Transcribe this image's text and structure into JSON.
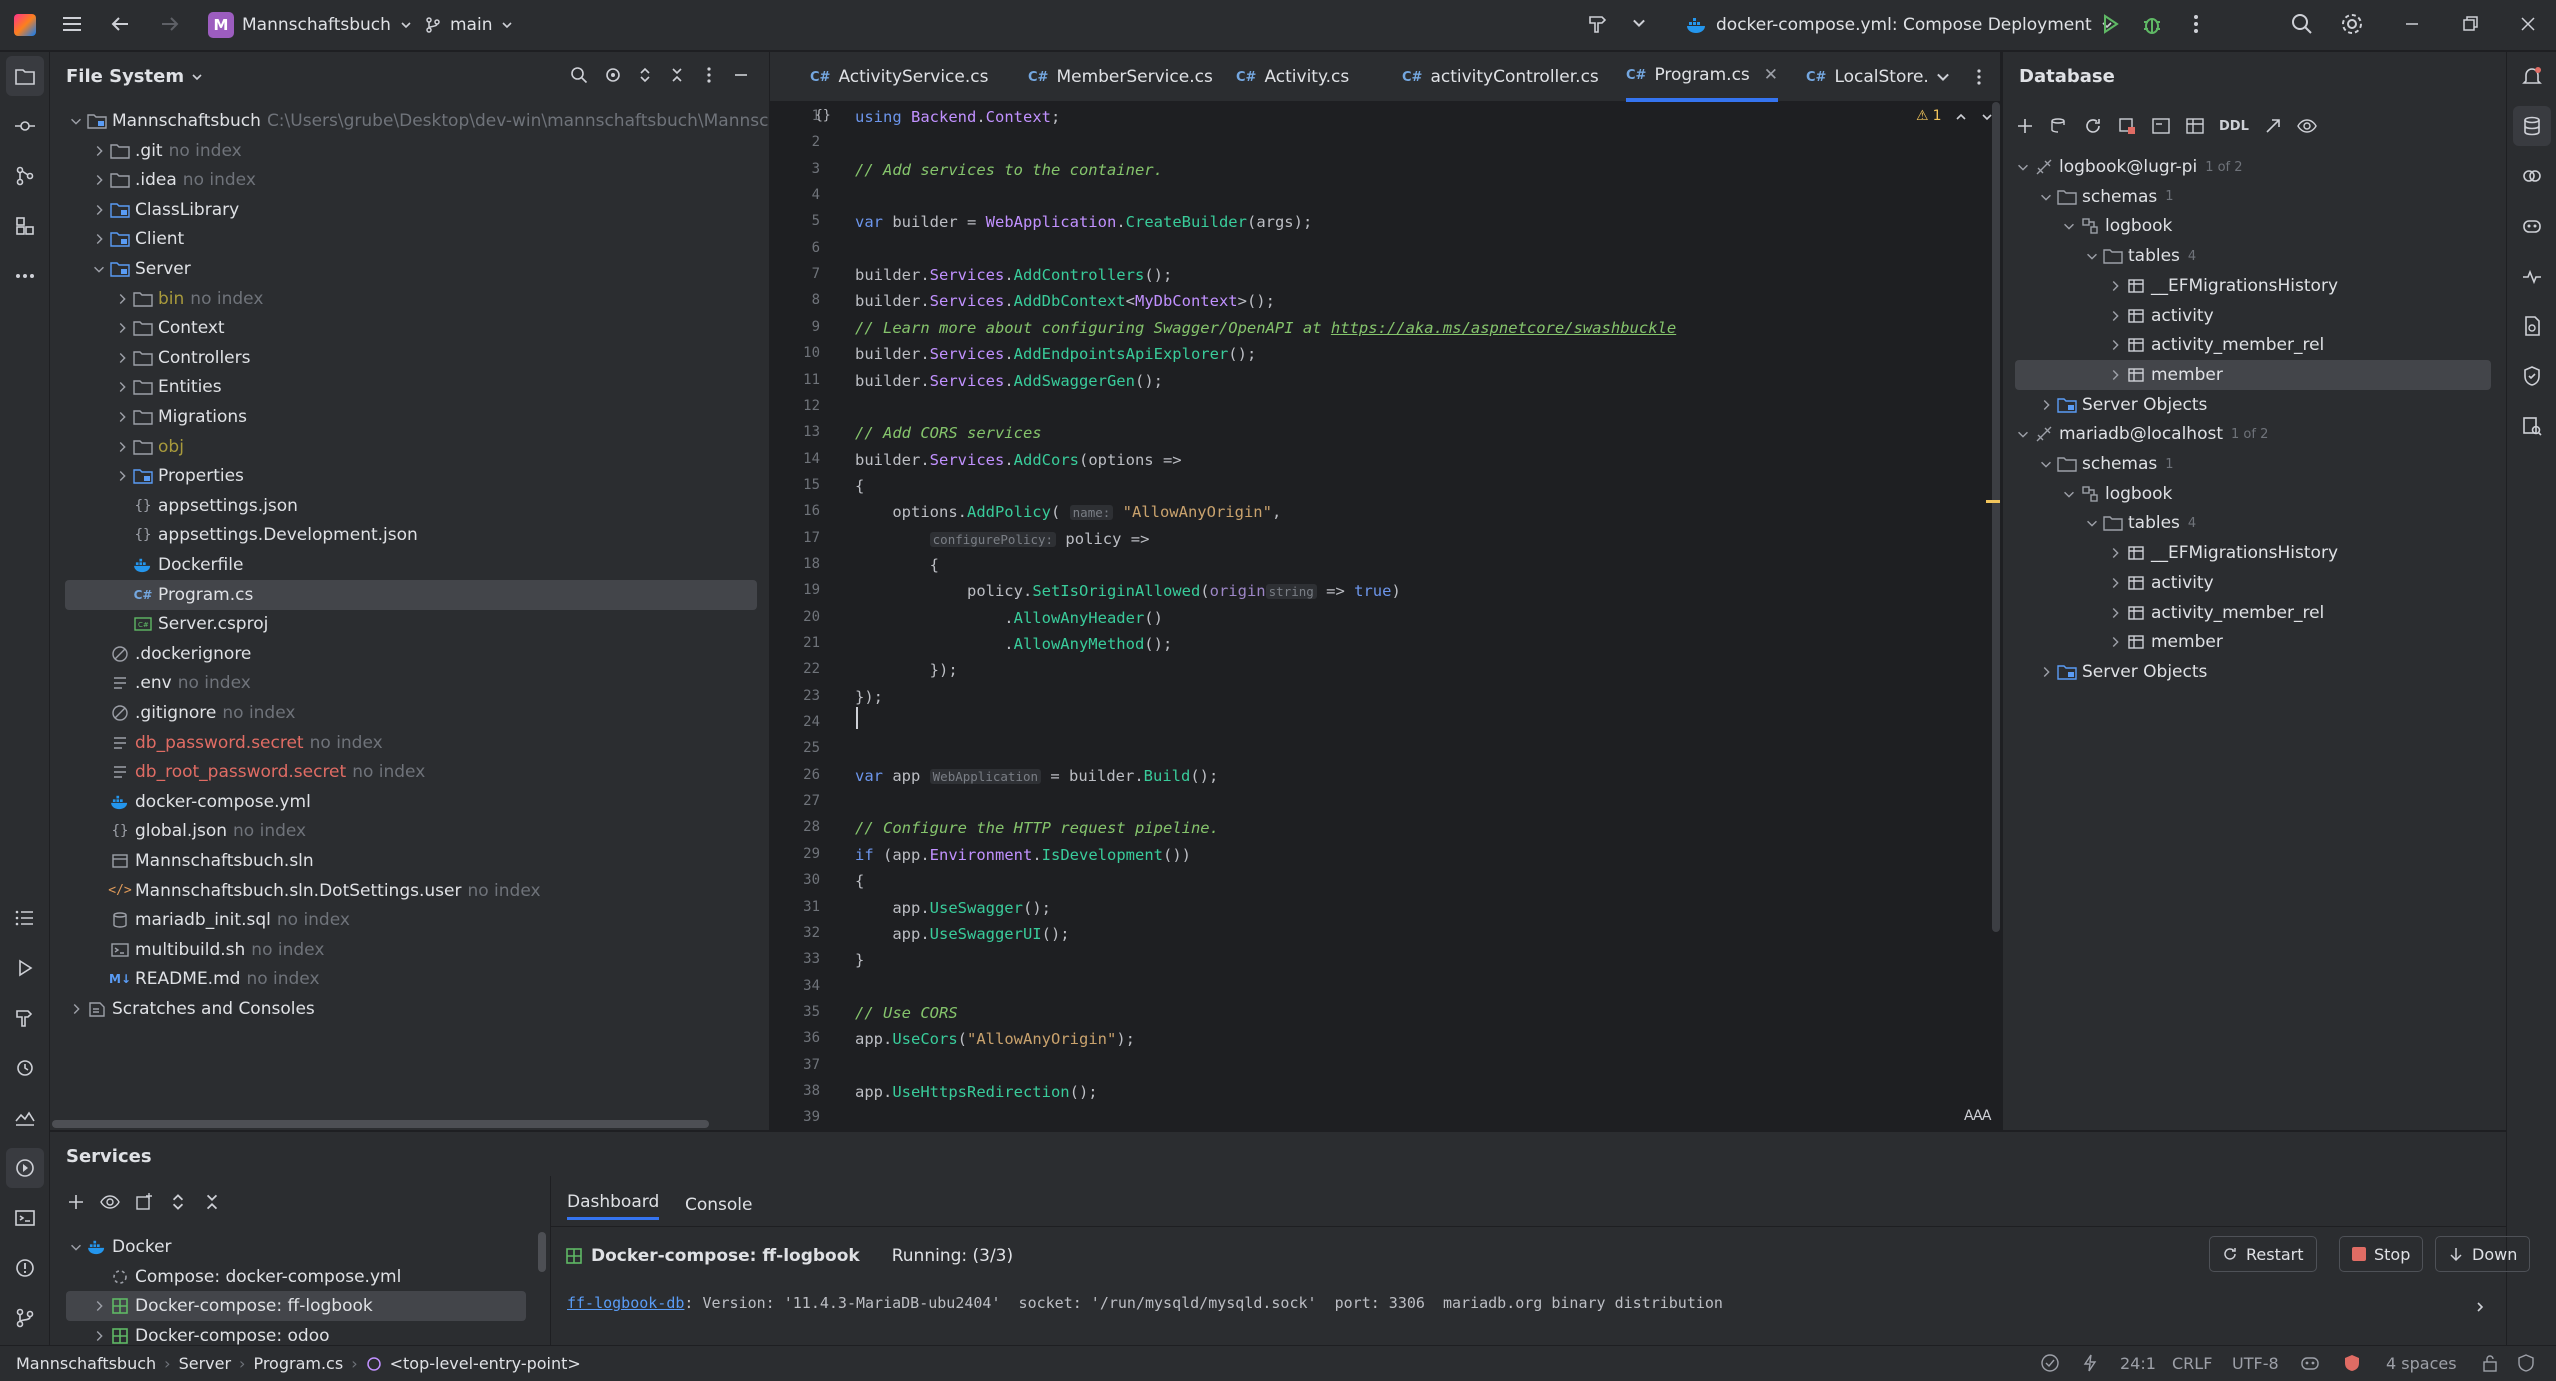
{
  "header": {
    "project_initial": "M",
    "project_name": "Mannschaftsbuch",
    "branch": "main",
    "run_config": "docker-compose.yml: Compose Deployment"
  },
  "filesystem": {
    "title": "File System",
    "root_name": "Mannschaftsbuch",
    "root_path": "C:\\Users\\grube\\Desktop\\dev-win\\mannschaftsbuch\\Mannschaftsbuch",
    "items": [
      {
        "label": "Mannschaftsbuch",
        "extra": "C:\\Users\\grube\\Desktop\\dev-win\\mannschaftsbuch\\Mannschaftsbuch",
        "level": 0,
        "chev": "down",
        "icon": "project-folder-icon"
      },
      {
        "label": ".git",
        "extra": "no index",
        "level": 1,
        "chev": "right",
        "icon": "folder-icon"
      },
      {
        "label": ".idea",
        "extra": "no index",
        "level": 1,
        "chev": "right",
        "icon": "folder-icon"
      },
      {
        "label": "ClassLibrary",
        "extra": "",
        "level": 1,
        "chev": "right",
        "icon": "module-folder-icon"
      },
      {
        "label": "Client",
        "extra": "",
        "level": 1,
        "chev": "right",
        "icon": "module-folder-icon"
      },
      {
        "label": "Server",
        "extra": "",
        "level": 1,
        "chev": "down",
        "icon": "module-folder-icon"
      },
      {
        "label": "bin",
        "extra": "no index",
        "level": 2,
        "chev": "right",
        "icon": "folder-icon",
        "color": "olive"
      },
      {
        "label": "Context",
        "extra": "",
        "level": 2,
        "chev": "right",
        "icon": "folder-icon"
      },
      {
        "label": "Controllers",
        "extra": "",
        "level": 2,
        "chev": "right",
        "icon": "folder-icon"
      },
      {
        "label": "Entities",
        "extra": "",
        "level": 2,
        "chev": "right",
        "icon": "folder-icon"
      },
      {
        "label": "Migrations",
        "extra": "",
        "level": 2,
        "chev": "right",
        "icon": "folder-icon"
      },
      {
        "label": "obj",
        "extra": "",
        "level": 2,
        "chev": "right",
        "icon": "folder-icon",
        "color": "olive"
      },
      {
        "label": "Properties",
        "extra": "",
        "level": 2,
        "chev": "right",
        "icon": "module-folder-icon"
      },
      {
        "label": "appsettings.json",
        "extra": "",
        "level": 2,
        "chev": "",
        "icon": "json-icon"
      },
      {
        "label": "appsettings.Development.json",
        "extra": "",
        "level": 2,
        "chev": "",
        "icon": "json-icon"
      },
      {
        "label": "Dockerfile",
        "extra": "",
        "level": 2,
        "chev": "",
        "icon": "docker-icon"
      },
      {
        "label": "Program.cs",
        "extra": "",
        "level": 2,
        "chev": "",
        "icon": "csharp-icon",
        "selected": true
      },
      {
        "label": "Server.csproj",
        "extra": "",
        "level": 2,
        "chev": "",
        "icon": "csproj-icon"
      },
      {
        "label": ".dockerignore",
        "extra": "",
        "level": 1,
        "chev": "",
        "icon": "ignore-icon"
      },
      {
        "label": ".env",
        "extra": "no index",
        "level": 1,
        "chev": "",
        "icon": "text-file-icon"
      },
      {
        "label": ".gitignore",
        "extra": "no index",
        "level": 1,
        "chev": "",
        "icon": "ignore-icon"
      },
      {
        "label": "db_password.secret",
        "extra": "no index",
        "level": 1,
        "chev": "",
        "icon": "text-file-icon",
        "color": "red"
      },
      {
        "label": "db_root_password.secret",
        "extra": "no index",
        "level": 1,
        "chev": "",
        "icon": "text-file-icon",
        "color": "red"
      },
      {
        "label": "docker-compose.yml",
        "extra": "",
        "level": 1,
        "chev": "",
        "icon": "docker-icon"
      },
      {
        "label": "global.json",
        "extra": "no index",
        "level": 1,
        "chev": "",
        "icon": "json-icon"
      },
      {
        "label": "Mannschaftsbuch.sln",
        "extra": "",
        "level": 1,
        "chev": "",
        "icon": "solution-icon"
      },
      {
        "label": "Mannschaftsbuch.sln.DotSettings.user",
        "extra": "no index",
        "level": 1,
        "chev": "",
        "icon": "xml-icon"
      },
      {
        "label": "mariadb_init.sql",
        "extra": "no index",
        "level": 1,
        "chev": "",
        "icon": "sql-icon"
      },
      {
        "label": "multibuild.sh",
        "extra": "no index",
        "level": 1,
        "chev": "",
        "icon": "shell-icon"
      },
      {
        "label": "README.md",
        "extra": "no index",
        "level": 1,
        "chev": "",
        "icon": "markdown-icon"
      },
      {
        "label": "Scratches and Consoles",
        "extra": "",
        "level": 0,
        "chev": "right",
        "icon": "scratches-icon"
      }
    ]
  },
  "editor": {
    "tabs": [
      {
        "label": "ActivityService.cs",
        "icon": "C#"
      },
      {
        "label": "MemberService.cs",
        "icon": "C#"
      },
      {
        "label": "Activity.cs",
        "icon": "C#"
      },
      {
        "label": "activityController.cs",
        "icon": "C#"
      },
      {
        "label": "Program.cs",
        "icon": "C#",
        "active": true
      },
      {
        "label": "LocalStore.",
        "icon": "C#"
      }
    ],
    "warning_count": "1",
    "lines": [
      [
        [
          "kw",
          "using "
        ],
        [
          "ty",
          "Backend"
        ],
        [
          "",
          "."
        ],
        [
          "ty",
          "Context"
        ],
        [
          "",
          ";"
        ]
      ],
      [],
      [
        [
          "cm",
          "// Add services to the container."
        ]
      ],
      [],
      [
        [
          "kw",
          "var "
        ],
        [
          "",
          "builder = "
        ],
        [
          "ty",
          "WebApplication"
        ],
        [
          "",
          "."
        ],
        [
          "me",
          "CreateBuilder"
        ],
        [
          "",
          "(args);"
        ]
      ],
      [],
      [
        [
          "",
          "builder."
        ],
        [
          "ty",
          "Services"
        ],
        [
          "",
          "."
        ],
        [
          "me",
          "AddControllers"
        ],
        [
          "",
          "();"
        ]
      ],
      [
        [
          "",
          "builder."
        ],
        [
          "ty",
          "Services"
        ],
        [
          "",
          "."
        ],
        [
          "me",
          "AddDbContext"
        ],
        [
          "",
          "<"
        ],
        [
          "ty",
          "MyDbContext"
        ],
        [
          "",
          ">();"
        ]
      ],
      [
        [
          "cm",
          "// Learn more about configuring Swagger/OpenAPI at "
        ],
        [
          "lk",
          "https://aka.ms/aspnetcore/swashbuckle"
        ]
      ],
      [
        [
          "",
          "builder."
        ],
        [
          "ty",
          "Services"
        ],
        [
          "",
          "."
        ],
        [
          "me",
          "AddEndpointsApiExplorer"
        ],
        [
          "",
          "();"
        ]
      ],
      [
        [
          "",
          "builder."
        ],
        [
          "ty",
          "Services"
        ],
        [
          "",
          "."
        ],
        [
          "me",
          "AddSwaggerGen"
        ],
        [
          "",
          "();"
        ]
      ],
      [],
      [
        [
          "cm",
          "// Add CORS services"
        ]
      ],
      [
        [
          "",
          "builder."
        ],
        [
          "ty",
          "Services"
        ],
        [
          "",
          "."
        ],
        [
          "me",
          "AddCors"
        ],
        [
          "",
          "(options =>"
        ]
      ],
      [
        [
          "",
          "{"
        ]
      ],
      [
        [
          "",
          "    options."
        ],
        [
          "me",
          "AddPolicy"
        ],
        [
          "",
          "( "
        ],
        [
          "hint",
          "name:"
        ],
        [
          "st",
          " \"AllowAnyOrigin\""
        ],
        [
          "",
          ","
        ]
      ],
      [
        [
          "",
          "        "
        ],
        [
          "hint",
          "configurePolicy:"
        ],
        [
          "",
          " policy =>"
        ]
      ],
      [
        [
          "",
          "        {"
        ]
      ],
      [
        [
          "",
          "            policy."
        ],
        [
          "me",
          "SetIsOriginAllowed"
        ],
        [
          "",
          "("
        ],
        [
          "pm",
          "origin"
        ],
        [
          "hint",
          "string"
        ],
        [
          "",
          " => "
        ],
        [
          "kw",
          "true"
        ],
        [
          "",
          ")"
        ]
      ],
      [
        [
          "",
          "                ."
        ],
        [
          "me",
          "AllowAnyHeader"
        ],
        [
          "",
          "()"
        ]
      ],
      [
        [
          "",
          "                ."
        ],
        [
          "me",
          "AllowAnyMethod"
        ],
        [
          "",
          "();"
        ]
      ],
      [
        [
          "",
          "        });"
        ]
      ],
      [
        [
          "",
          "});"
        ]
      ],
      [],
      [],
      [
        [
          "kw",
          "var "
        ],
        [
          "",
          "app "
        ],
        [
          "hint",
          "WebApplication"
        ],
        [
          "",
          " = builder."
        ],
        [
          "me",
          "Build"
        ],
        [
          "",
          "();"
        ]
      ],
      [],
      [
        [
          "cm",
          "// Configure the HTTP request pipeline."
        ]
      ],
      [
        [
          "kw",
          "if "
        ],
        [
          "",
          "(app."
        ],
        [
          "ty",
          "Environment"
        ],
        [
          "",
          "."
        ],
        [
          "me",
          "IsDevelopment"
        ],
        [
          "",
          "())"
        ]
      ],
      [
        [
          "",
          "{"
        ]
      ],
      [
        [
          "",
          "    app."
        ],
        [
          "me",
          "UseSwagger"
        ],
        [
          "",
          "();"
        ]
      ],
      [
        [
          "",
          "    app."
        ],
        [
          "me",
          "UseSwaggerUI"
        ],
        [
          "",
          "();"
        ]
      ],
      [
        [
          "",
          "}"
        ]
      ],
      [],
      [
        [
          "cm",
          "// Use CORS"
        ]
      ],
      [
        [
          "",
          "app."
        ],
        [
          "me",
          "UseCors"
        ],
        [
          "",
          "("
        ],
        [
          "st",
          "\"AllowAnyOrigin\""
        ],
        [
          "",
          ");"
        ]
      ],
      [],
      [
        [
          "",
          "app."
        ],
        [
          "me",
          "UseHttpsRedirection"
        ],
        [
          "",
          "();"
        ]
      ],
      []
    ]
  },
  "database": {
    "title": "Database",
    "toolbar_ddl": "DDL",
    "items": [
      {
        "label": "logbook@lugr-pi",
        "badge": "1 of 2",
        "level": 0,
        "chev": "down",
        "icon": "datasource-icon"
      },
      {
        "label": "schemas",
        "badge": "1",
        "level": 1,
        "chev": "down",
        "icon": "folder-icon"
      },
      {
        "label": "logbook",
        "badge": "",
        "level": 2,
        "chev": "down",
        "icon": "schema-icon"
      },
      {
        "label": "tables",
        "badge": "4",
        "level": 3,
        "chev": "down",
        "icon": "folder-icon"
      },
      {
        "label": "__EFMigrationsHistory",
        "badge": "",
        "level": 4,
        "chev": "right",
        "icon": "table-icon"
      },
      {
        "label": "activity",
        "badge": "",
        "level": 4,
        "chev": "right",
        "icon": "table-icon"
      },
      {
        "label": "activity_member_rel",
        "badge": "",
        "level": 4,
        "chev": "right",
        "icon": "table-icon"
      },
      {
        "label": "member",
        "badge": "",
        "level": 4,
        "chev": "right",
        "icon": "table-icon",
        "selected": true
      },
      {
        "label": "Server Objects",
        "badge": "",
        "level": 1,
        "chev": "right",
        "icon": "server-objects-icon"
      },
      {
        "label": "mariadb@localhost",
        "badge": "1 of 2",
        "level": 0,
        "chev": "down",
        "icon": "datasource-icon"
      },
      {
        "label": "schemas",
        "badge": "1",
        "level": 1,
        "chev": "down",
        "icon": "folder-icon"
      },
      {
        "label": "logbook",
        "badge": "",
        "level": 2,
        "chev": "down",
        "icon": "schema-icon"
      },
      {
        "label": "tables",
        "badge": "4",
        "level": 3,
        "chev": "down",
        "icon": "folder-icon"
      },
      {
        "label": "__EFMigrationsHistory",
        "badge": "",
        "level": 4,
        "chev": "right",
        "icon": "table-icon"
      },
      {
        "label": "activity",
        "badge": "",
        "level": 4,
        "chev": "right",
        "icon": "table-icon"
      },
      {
        "label": "activity_member_rel",
        "badge": "",
        "level": 4,
        "chev": "right",
        "icon": "table-icon"
      },
      {
        "label": "member",
        "badge": "",
        "level": 4,
        "chev": "right",
        "icon": "table-icon"
      },
      {
        "label": "Server Objects",
        "badge": "",
        "level": 1,
        "chev": "right",
        "icon": "server-objects-icon"
      }
    ]
  },
  "services": {
    "title": "Services",
    "tree": [
      {
        "label": "Docker",
        "level": 0,
        "chev": "down",
        "icon": "docker-icon"
      },
      {
        "label": "Compose: docker-compose.yml",
        "level": 1,
        "chev": "",
        "icon": "spinner-icon"
      },
      {
        "label": "Docker-compose: ff-logbook",
        "level": 1,
        "chev": "right",
        "icon": "compose-icon",
        "selected": true
      },
      {
        "label": "Docker-compose: odoo",
        "level": 1,
        "chev": "right",
        "icon": "compose-icon"
      }
    ],
    "tabs": [
      "Dashboard",
      "Console"
    ],
    "active_tab": "Dashboard",
    "compose_name": "Docker-compose: ff-logbook",
    "running": "Running: (3/3)",
    "restart_label": "Restart",
    "stop_label": "Stop",
    "down_label": "Down",
    "log_link": "ff-logbook-db",
    "log_text": ": Version: '11.4.3-MariaDB-ubu2404'  socket: '/run/mysqld/mysqld.sock'  port: 3306  mariadb.org binary distribution"
  },
  "statusbar": {
    "breadcrumb": [
      "Mannschaftsbuch",
      "Server",
      "Program.cs",
      "<top-level-entry-point>"
    ],
    "position": "24:1",
    "line_ending": "CRLF",
    "encoding": "UTF-8",
    "indent": "4 spaces"
  }
}
